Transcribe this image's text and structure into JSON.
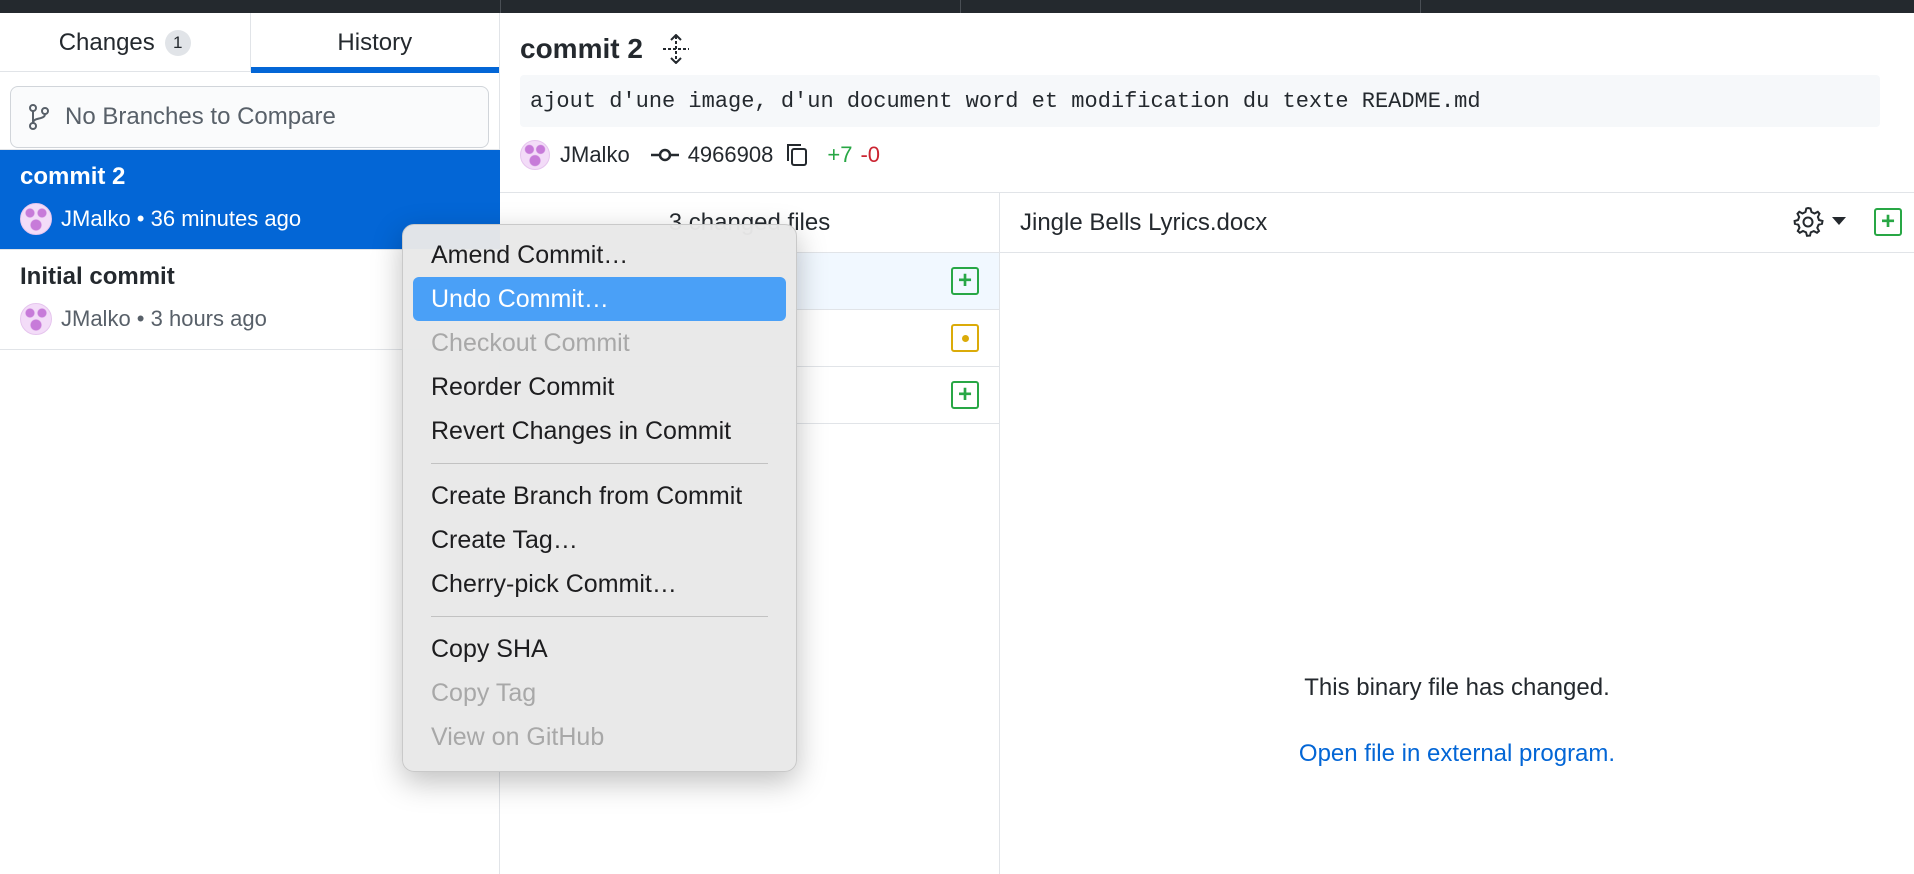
{
  "sidebar": {
    "tabs": [
      {
        "label": "Changes",
        "badge": "1"
      },
      {
        "label": "History"
      }
    ],
    "compare_placeholder": "No Branches to Compare",
    "commits": [
      {
        "title": "commit 2",
        "author": "JMalko",
        "time": "36 minutes ago"
      },
      {
        "title": "Initial commit",
        "author": "JMalko",
        "time": "3 hours ago"
      }
    ]
  },
  "commit": {
    "summary": "commit 2",
    "description": "ajout d'une image, d'un document word et modification du texte README.md",
    "author": "JMalko",
    "sha": "4966908",
    "additions": "+7",
    "deletions": "-0"
  },
  "files": {
    "header": "3 changed files"
  },
  "diff": {
    "filename": "Jingle Bells Lyrics.docx",
    "binary_message": "This binary file has changed.",
    "open_link": "Open file in external program."
  },
  "context_menu": {
    "items": [
      {
        "label": "Amend Commit…",
        "state": "enabled"
      },
      {
        "label": "Undo Commit…",
        "state": "highlighted"
      },
      {
        "label": "Checkout Commit",
        "state": "disabled"
      },
      {
        "label": "Reorder Commit",
        "state": "enabled"
      },
      {
        "label": "Revert Changes in Commit",
        "state": "enabled"
      },
      {
        "label": "Create Branch from Commit",
        "state": "enabled"
      },
      {
        "label": "Create Tag…",
        "state": "enabled"
      },
      {
        "label": "Cherry-pick Commit…",
        "state": "enabled"
      },
      {
        "label": "Copy SHA",
        "state": "enabled"
      },
      {
        "label": "Copy Tag",
        "state": "disabled"
      },
      {
        "label": "View on GitHub",
        "state": "disabled"
      }
    ]
  },
  "colors": {
    "accent": "#0366d6",
    "menu_highlight": "#4aa0f7",
    "added": "#28a745",
    "deleted": "#cb2431",
    "modified": "#dbab09"
  }
}
